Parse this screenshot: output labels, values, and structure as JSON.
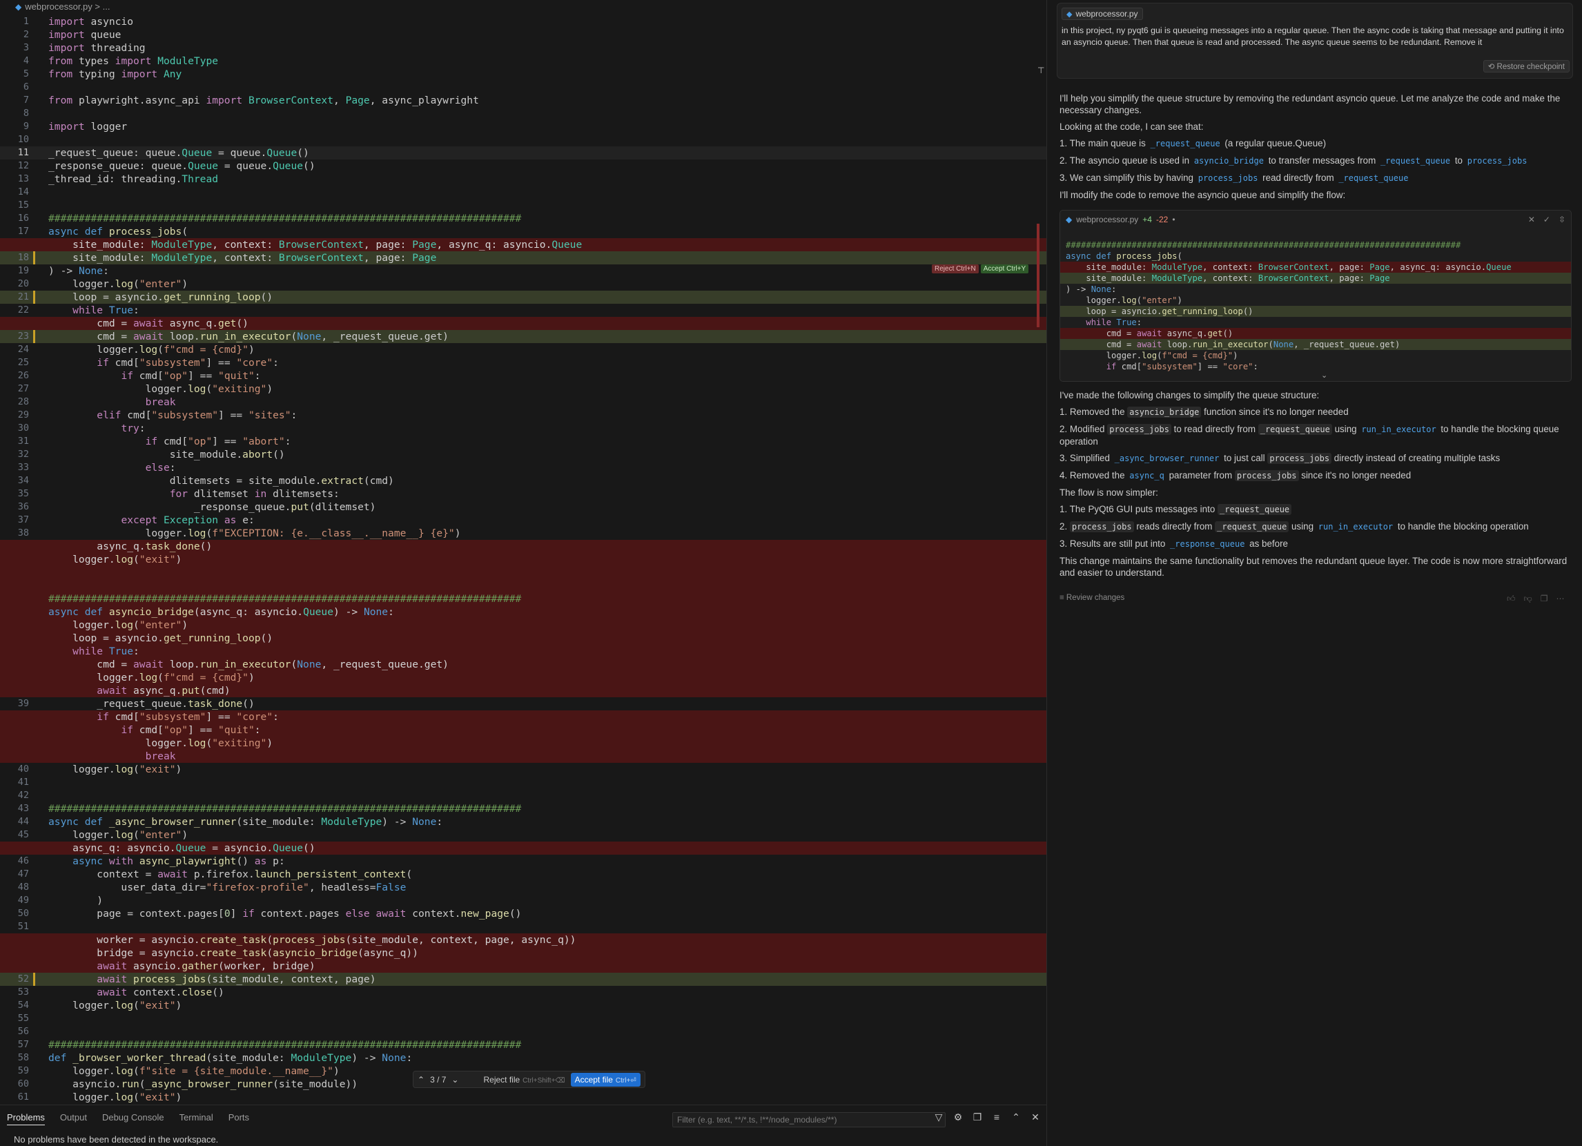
{
  "editor": {
    "breadcrumb_file": "webprocessor.py",
    "breadcrumb_rest": "> ...",
    "inline_reject": "Reject Ctrl+N",
    "inline_accept": "Accept Ctrl+Y",
    "lines": [
      {
        "n": "1",
        "t": "import asyncio",
        "s": "n"
      },
      {
        "n": "2",
        "t": "import queue",
        "s": "n"
      },
      {
        "n": "3",
        "t": "import threading",
        "s": "n"
      },
      {
        "n": "4",
        "t": "from types import ModuleType",
        "s": "n"
      },
      {
        "n": "5",
        "t": "from typing import Any",
        "s": "n"
      },
      {
        "n": "6",
        "t": "",
        "s": "n"
      },
      {
        "n": "7",
        "t": "from playwright.async_api import BrowserContext, Page, async_playwright",
        "s": "n"
      },
      {
        "n": "8",
        "t": "",
        "s": "n"
      },
      {
        "n": "9",
        "t": "import logger",
        "s": "n"
      },
      {
        "n": "10",
        "t": "",
        "s": "n"
      },
      {
        "n": "11",
        "t": "_request_queue: queue.Queue = queue.Queue()",
        "s": "c"
      },
      {
        "n": "12",
        "t": "_response_queue: queue.Queue = queue.Queue()",
        "s": "n"
      },
      {
        "n": "13",
        "t": "_thread_id: threading.Thread",
        "s": "n"
      },
      {
        "n": "14",
        "t": "",
        "s": "n"
      },
      {
        "n": "15",
        "t": "",
        "s": "n"
      },
      {
        "n": "16",
        "t": "##############################################################################",
        "s": "n"
      },
      {
        "n": "17",
        "t": "async def process_jobs(",
        "s": "n"
      },
      {
        "n": "",
        "t": "    site_module: ModuleType, context: BrowserContext, page: Page, async_q: asyncio.Queue",
        "s": "d"
      },
      {
        "n": "18",
        "t": "    site_module: ModuleType, context: BrowserContext, page: Page",
        "s": "a"
      },
      {
        "n": "19",
        "t": ") -> None:",
        "s": "n"
      },
      {
        "n": "20",
        "t": "    logger.log(\"enter\")",
        "s": "n"
      },
      {
        "n": "21",
        "t": "    loop = asyncio.get_running_loop()",
        "s": "a"
      },
      {
        "n": "22",
        "t": "    while True:",
        "s": "n"
      },
      {
        "n": "",
        "t": "        cmd = await async_q.get()",
        "s": "d"
      },
      {
        "n": "23",
        "t": "        cmd = await loop.run_in_executor(None, _request_queue.get)",
        "s": "a"
      },
      {
        "n": "24",
        "t": "        logger.log(f\"cmd = {cmd}\")",
        "s": "n"
      },
      {
        "n": "25",
        "t": "        if cmd[\"subsystem\"] == \"core\":",
        "s": "n"
      },
      {
        "n": "26",
        "t": "            if cmd[\"op\"] == \"quit\":",
        "s": "n"
      },
      {
        "n": "27",
        "t": "                logger.log(\"exiting\")",
        "s": "n"
      },
      {
        "n": "28",
        "t": "                break",
        "s": "n"
      },
      {
        "n": "29",
        "t": "        elif cmd[\"subsystem\"] == \"sites\":",
        "s": "n"
      },
      {
        "n": "30",
        "t": "            try:",
        "s": "n"
      },
      {
        "n": "31",
        "t": "                if cmd[\"op\"] == \"abort\":",
        "s": "n"
      },
      {
        "n": "32",
        "t": "                    site_module.abort()",
        "s": "n"
      },
      {
        "n": "33",
        "t": "                else:",
        "s": "n"
      },
      {
        "n": "34",
        "t": "                    dlitemsets = site_module.extract(cmd)",
        "s": "n"
      },
      {
        "n": "35",
        "t": "                    for dlitemset in dlitemsets:",
        "s": "n"
      },
      {
        "n": "36",
        "t": "                        _response_queue.put(dlitemset)",
        "s": "n"
      },
      {
        "n": "37",
        "t": "            except Exception as e:",
        "s": "n"
      },
      {
        "n": "38",
        "t": "                logger.log(f\"EXCEPTION: {e.__class__.__name__} {e}\")",
        "s": "n"
      },
      {
        "n": "",
        "t": "        async_q.task_done()",
        "s": "d"
      },
      {
        "n": "",
        "t": "    logger.log(\"exit\")",
        "s": "d"
      },
      {
        "n": "",
        "t": "",
        "s": "d"
      },
      {
        "n": "",
        "t": "",
        "s": "d"
      },
      {
        "n": "",
        "t": "##############################################################################",
        "s": "d"
      },
      {
        "n": "",
        "t": "async def asyncio_bridge(async_q: asyncio.Queue) -> None:",
        "s": "d"
      },
      {
        "n": "",
        "t": "    logger.log(\"enter\")",
        "s": "d"
      },
      {
        "n": "",
        "t": "    loop = asyncio.get_running_loop()",
        "s": "d"
      },
      {
        "n": "",
        "t": "    while True:",
        "s": "d"
      },
      {
        "n": "",
        "t": "        cmd = await loop.run_in_executor(None, _request_queue.get)",
        "s": "d"
      },
      {
        "n": "",
        "t": "        logger.log(f\"cmd = {cmd}\")",
        "s": "d"
      },
      {
        "n": "",
        "t": "        await async_q.put(cmd)",
        "s": "d"
      },
      {
        "n": "39",
        "t": "        _request_queue.task_done()",
        "s": "n"
      },
      {
        "n": "",
        "t": "        if cmd[\"subsystem\"] == \"core\":",
        "s": "d"
      },
      {
        "n": "",
        "t": "            if cmd[\"op\"] == \"quit\":",
        "s": "d"
      },
      {
        "n": "",
        "t": "                logger.log(\"exiting\")",
        "s": "d"
      },
      {
        "n": "",
        "t": "                break",
        "s": "d"
      },
      {
        "n": "40",
        "t": "    logger.log(\"exit\")",
        "s": "n"
      },
      {
        "n": "41",
        "t": "",
        "s": "n"
      },
      {
        "n": "42",
        "t": "",
        "s": "n"
      },
      {
        "n": "43",
        "t": "##############################################################################",
        "s": "n"
      },
      {
        "n": "44",
        "t": "async def _async_browser_runner(site_module: ModuleType) -> None:",
        "s": "n"
      },
      {
        "n": "45",
        "t": "    logger.log(\"enter\")",
        "s": "n"
      },
      {
        "n": "",
        "t": "    async_q: asyncio.Queue = asyncio.Queue()",
        "s": "d"
      },
      {
        "n": "46",
        "t": "    async with async_playwright() as p:",
        "s": "n"
      },
      {
        "n": "47",
        "t": "        context = await p.firefox.launch_persistent_context(",
        "s": "n"
      },
      {
        "n": "48",
        "t": "            user_data_dir=\"firefox-profile\", headless=False",
        "s": "n"
      },
      {
        "n": "49",
        "t": "        )",
        "s": "n"
      },
      {
        "n": "50",
        "t": "        page = context.pages[0] if context.pages else await context.new_page()",
        "s": "n"
      },
      {
        "n": "51",
        "t": "",
        "s": "n"
      },
      {
        "n": "",
        "t": "        worker = asyncio.create_task(process_jobs(site_module, context, page, async_q))",
        "s": "d"
      },
      {
        "n": "",
        "t": "        bridge = asyncio.create_task(asyncio_bridge(async_q))",
        "s": "d"
      },
      {
        "n": "",
        "t": "        await asyncio.gather(worker, bridge)",
        "s": "d"
      },
      {
        "n": "52",
        "t": "        await process_jobs(site_module, context, page)",
        "s": "a"
      },
      {
        "n": "53",
        "t": "        await context.close()",
        "s": "n"
      },
      {
        "n": "54",
        "t": "    logger.log(\"exit\")",
        "s": "n"
      },
      {
        "n": "55",
        "t": "",
        "s": "n"
      },
      {
        "n": "56",
        "t": "",
        "s": "n"
      },
      {
        "n": "57",
        "t": "##############################################################################",
        "s": "n"
      },
      {
        "n": "58",
        "t": "def _browser_worker_thread(site_module: ModuleType) -> None:",
        "s": "n"
      },
      {
        "n": "59",
        "t": "    logger.log(f\"site = {site_module.__name__}\")",
        "s": "n"
      },
      {
        "n": "60",
        "t": "    asyncio.run(_async_browser_runner(site_module))",
        "s": "n"
      },
      {
        "n": "61",
        "t": "    logger.log(\"exit\")",
        "s": "n"
      }
    ],
    "file_nav": {
      "counter": "3 / 7",
      "reject_label": "Reject file",
      "reject_kbd": "Ctrl+Shift+⌫",
      "accept_label": "Accept file",
      "accept_kbd": "Ctrl+⏎"
    }
  },
  "panel": {
    "tabs": [
      "Problems",
      "Output",
      "Debug Console",
      "Terminal",
      "Ports"
    ],
    "active_tab": "Problems",
    "filter_placeholder": "Filter (e.g. text, **/*.ts, !**/node_modules/**)",
    "message": "No problems have been detected in the workspace.",
    "icons": [
      "filter-icon",
      "settings-icon",
      "copy-icon",
      "wrap-icon",
      "chevron-up-icon",
      "close-icon"
    ]
  },
  "chat": {
    "prompt_chip": "webprocessor.py",
    "prompt_text": "in this project, ny pyqt6 gui is queueing messages into a regular queue. Then the async code is taking that message and putting it into an asyncio queue. Then that queue is read and processed. The async queue seems to be redundant. Remove it",
    "restore_label": "Restore checkpoint",
    "intro": "I'll help you simplify the queue structure by removing the redundant asyncio queue. Let me analyze the code and make the necessary changes.",
    "looking": "Looking at the code, I can see that:",
    "modify": "I'll modify the code to remove the asyncio queue and simplify the flow:",
    "diff_card": {
      "file": "webprocessor.py",
      "plus": "+4",
      "minus": "-22",
      "lines": [
        {
          "t": "",
          "s": "n"
        },
        {
          "t": "##############################################################################",
          "s": "n"
        },
        {
          "t": "async def process_jobs(",
          "s": "n"
        },
        {
          "t": "    site_module: ModuleType, context: BrowserContext, page: Page, async_q: asyncio.Queue",
          "s": "d"
        },
        {
          "t": "    site_module: ModuleType, context: BrowserContext, page: Page",
          "s": "a"
        },
        {
          "t": ") -> None:",
          "s": "n"
        },
        {
          "t": "    logger.log(\"enter\")",
          "s": "n"
        },
        {
          "t": "    loop = asyncio.get_running_loop()",
          "s": "a"
        },
        {
          "t": "    while True:",
          "s": "n"
        },
        {
          "t": "        cmd = await async_q.get()",
          "s": "d"
        },
        {
          "t": "        cmd = await loop.run_in_executor(None, _request_queue.get)",
          "s": "a"
        },
        {
          "t": "        logger.log(f\"cmd = {cmd}\")",
          "s": "n"
        },
        {
          "t": "        if cmd[\"subsystem\"] == \"core\":",
          "s": "n"
        }
      ]
    },
    "changes_intro": "I've made the following changes to simplify the queue structure:",
    "flow_intro": "The flow is now simpler:",
    "closing": "This change maintains the same functionality but removes the redundant queue layer. The code is now more straightforward and easier to understand.",
    "review_label": "Review changes",
    "msg_icons": [
      "thumbs-up-icon",
      "thumbs-down-icon",
      "copy-icon",
      "more-icon"
    ]
  }
}
